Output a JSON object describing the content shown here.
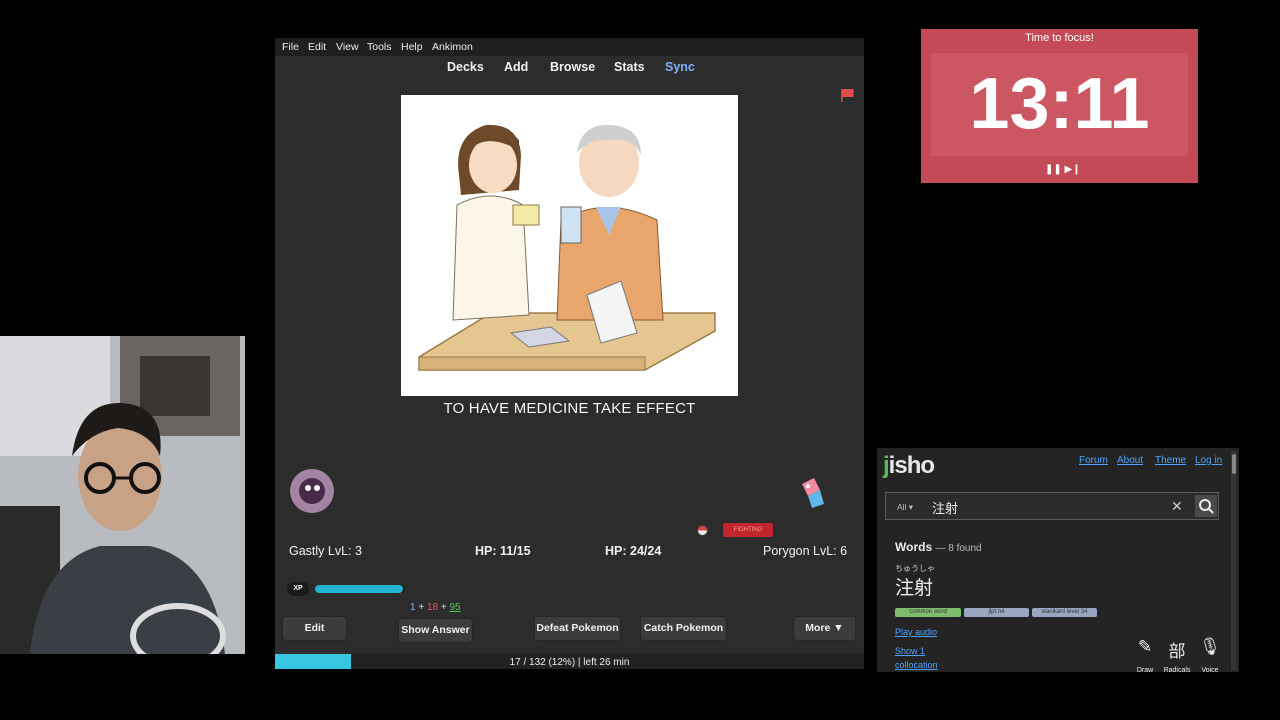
{
  "anki": {
    "menu": [
      "File",
      "Edit",
      "View",
      "Tools",
      "Help",
      "Ankimon"
    ],
    "toolbar": [
      "Decks",
      "Add",
      "Browse",
      "Stats",
      "Sync"
    ],
    "card_text": "TO HAVE MEDICINE TAKE EFFECT",
    "left_pokemon": "Gastly LvL: 3",
    "left_hp": "HP: 11/15",
    "right_hp": "HP: 24/24",
    "right_pokemon": "Porygon LvL: 6",
    "type_badge": "FIGHTING",
    "xp_label": "XP",
    "xp_fraction": 0.98,
    "counts": {
      "new": "1",
      "plus1": "+",
      "learn": "18",
      "plus2": "+",
      "review": "95"
    },
    "buttons": {
      "edit": "Edit",
      "show_answer": "Show Answer",
      "defeat": "Defeat Pokemon",
      "catch": "Catch Pokemon",
      "more": "More ▼"
    },
    "progress_fraction": 0.129,
    "progress_text": "17 / 132 (12%) | left 26 min"
  },
  "timer": {
    "title": "Time to focus!",
    "time": "13:11",
    "controls": "❚❚ ▶❙"
  },
  "jisho": {
    "logo_j": "j",
    "logo_rest": "isho",
    "nav": [
      "Forum",
      "About",
      "Theme",
      "Log in"
    ],
    "filter": "All ▾",
    "query": "注射",
    "clear_icon": "✕",
    "words_heading": "Words",
    "words_count": "— 8 found",
    "furigana": "ちゅうしゃ",
    "word": "注射",
    "tags": [
      "common word",
      "jlpt n4",
      "wanikani level 34"
    ],
    "links": [
      "Play audio",
      "Show 1",
      "collocation"
    ],
    "tools": [
      {
        "glyph": "✎",
        "label": "Draw"
      },
      {
        "glyph": "部",
        "label": "Radicals"
      },
      {
        "glyph": "🎙",
        "label": "Voice"
      }
    ]
  },
  "colors": {
    "anki_bg": "#2c2c2c",
    "xp": "#21b3cf",
    "timer_bg": "#c44a57",
    "jisho_green": "#5cb860",
    "link": "#4ea3ff",
    "count_red": "#e05a5a",
    "count_green": "#56c35c",
    "count_blue": "#7ab4ff"
  }
}
